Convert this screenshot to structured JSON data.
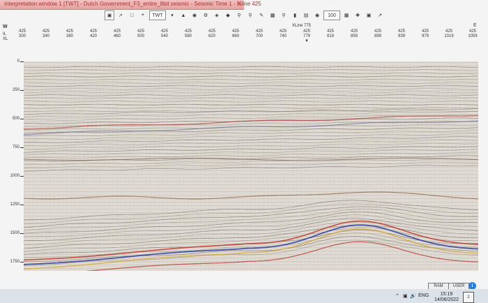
{
  "window": {
    "title": "Interpretation window 1 [TWT] - Dutch Government_F3_entire_8bit seismic - Seismic Time 1 - Inline 425",
    "close_label": "X"
  },
  "toolbar": {
    "domain_label": "TWT",
    "zoom_value": "100"
  },
  "header": {
    "side_label": "W",
    "row1_label": "IL",
    "row2_label": "XL",
    "right_label": "E",
    "xline_label": "XLine 775",
    "xline_value_top": "425",
    "xline_value_bottom": "779",
    "xline_marker": "▼",
    "ticks": [
      {
        "il": "425",
        "xl": "300"
      },
      {
        "il": "425",
        "xl": "340"
      },
      {
        "il": "425",
        "xl": "380"
      },
      {
        "il": "425",
        "xl": "420"
      },
      {
        "il": "425",
        "xl": "460"
      },
      {
        "il": "425",
        "xl": "500"
      },
      {
        "il": "425",
        "xl": "540"
      },
      {
        "il": "425",
        "xl": "580"
      },
      {
        "il": "425",
        "xl": "620"
      },
      {
        "il": "425",
        "xl": "660"
      },
      {
        "il": "425",
        "xl": "700"
      },
      {
        "il": "425",
        "xl": "740"
      },
      {
        "il": "425",
        "xl": "819"
      },
      {
        "il": "425",
        "xl": "859"
      },
      {
        "il": "425",
        "xl": "899"
      },
      {
        "il": "425",
        "xl": "939"
      },
      {
        "il": "425",
        "xl": "979"
      },
      {
        "il": "425",
        "xl": "1019"
      },
      {
        "il": "425",
        "xl": "1059"
      }
    ]
  },
  "yaxis": {
    "labels": [
      "0",
      "250",
      "500",
      "750",
      "1000",
      "1250",
      "1500",
      "1750"
    ]
  },
  "status": {
    "ram_label": "RAM",
    "user_label": "USER",
    "info_label": "i"
  },
  "taskbar": {
    "language": "ENG",
    "time": "15:19",
    "date": "14/06/2022",
    "notification_count": "2"
  }
}
